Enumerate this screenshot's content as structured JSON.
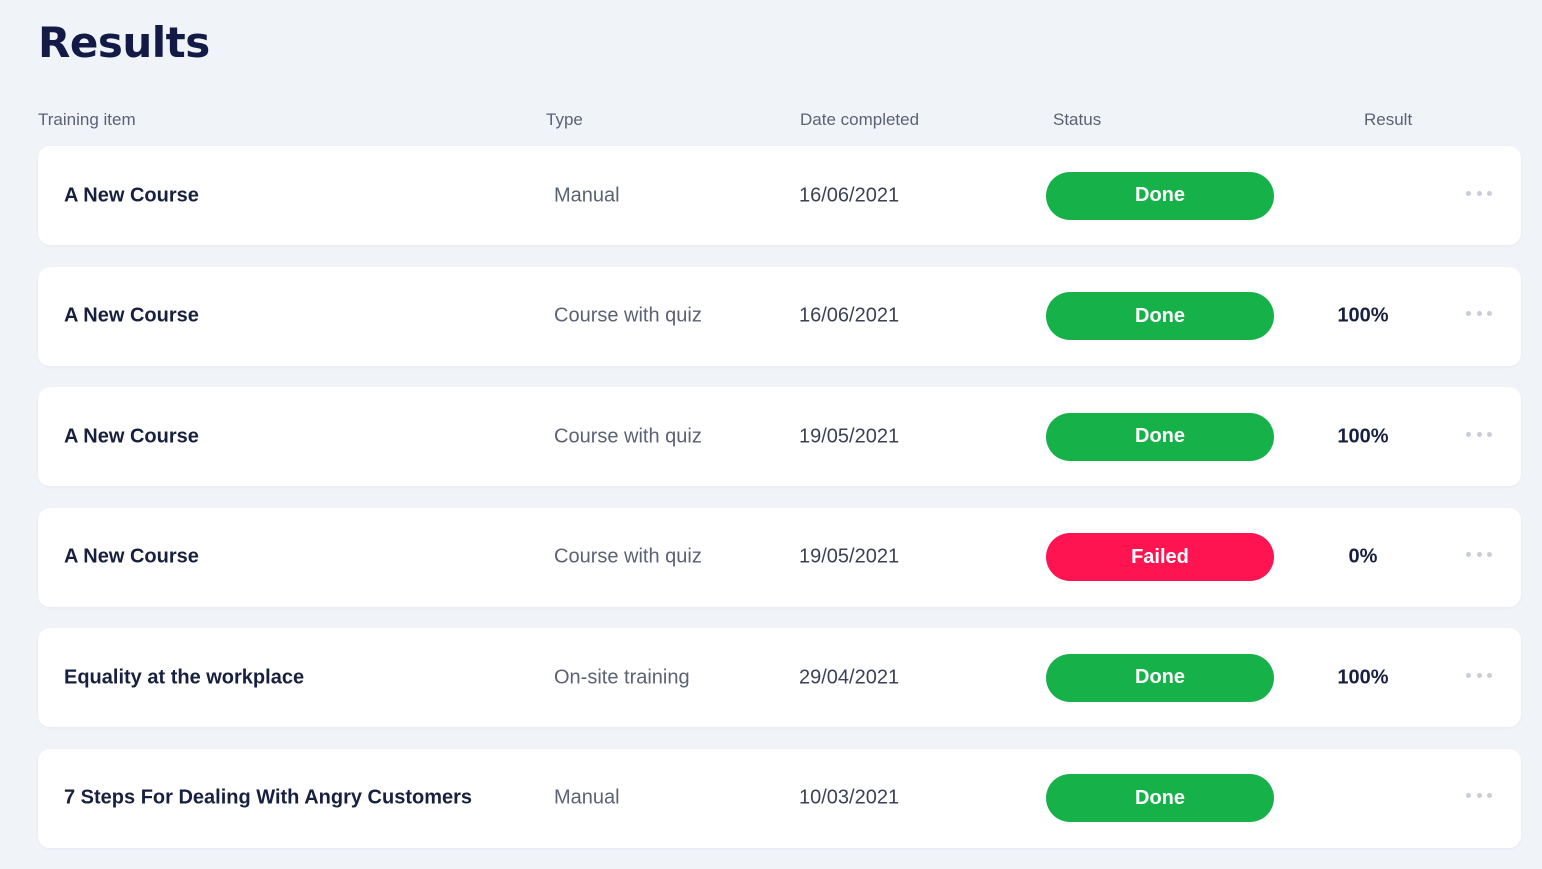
{
  "page": {
    "title": "Results"
  },
  "columns": {
    "training_item": "Training item",
    "type": "Type",
    "date_completed": "Date completed",
    "status": "Status",
    "result": "Result"
  },
  "colors": {
    "done": "#17b14a",
    "failed": "#ff1452",
    "background": "#f0f3f8"
  },
  "rows": [
    {
      "name": "A New Course",
      "type": "Manual",
      "date": "16/06/2021",
      "status": "Done",
      "status_kind": "done",
      "result": ""
    },
    {
      "name": "A New Course",
      "type": "Course with quiz",
      "date": "16/06/2021",
      "status": "Done",
      "status_kind": "done",
      "result": "100%"
    },
    {
      "name": "A New Course",
      "type": "Course with quiz",
      "date": "19/05/2021",
      "status": "Done",
      "status_kind": "done",
      "result": "100%"
    },
    {
      "name": "A New Course",
      "type": "Course with quiz",
      "date": "19/05/2021",
      "status": "Failed",
      "status_kind": "failed",
      "result": "0%"
    },
    {
      "name": "Equality at the workplace",
      "type": "On-site training",
      "date": "29/04/2021",
      "status": "Done",
      "status_kind": "done",
      "result": "100%"
    },
    {
      "name": "7 Steps For Dealing With Angry Customers",
      "type": "Manual",
      "date": "10/03/2021",
      "status": "Done",
      "status_kind": "done",
      "result": ""
    }
  ],
  "icons": {
    "row_menu": "more-horizontal-icon"
  }
}
